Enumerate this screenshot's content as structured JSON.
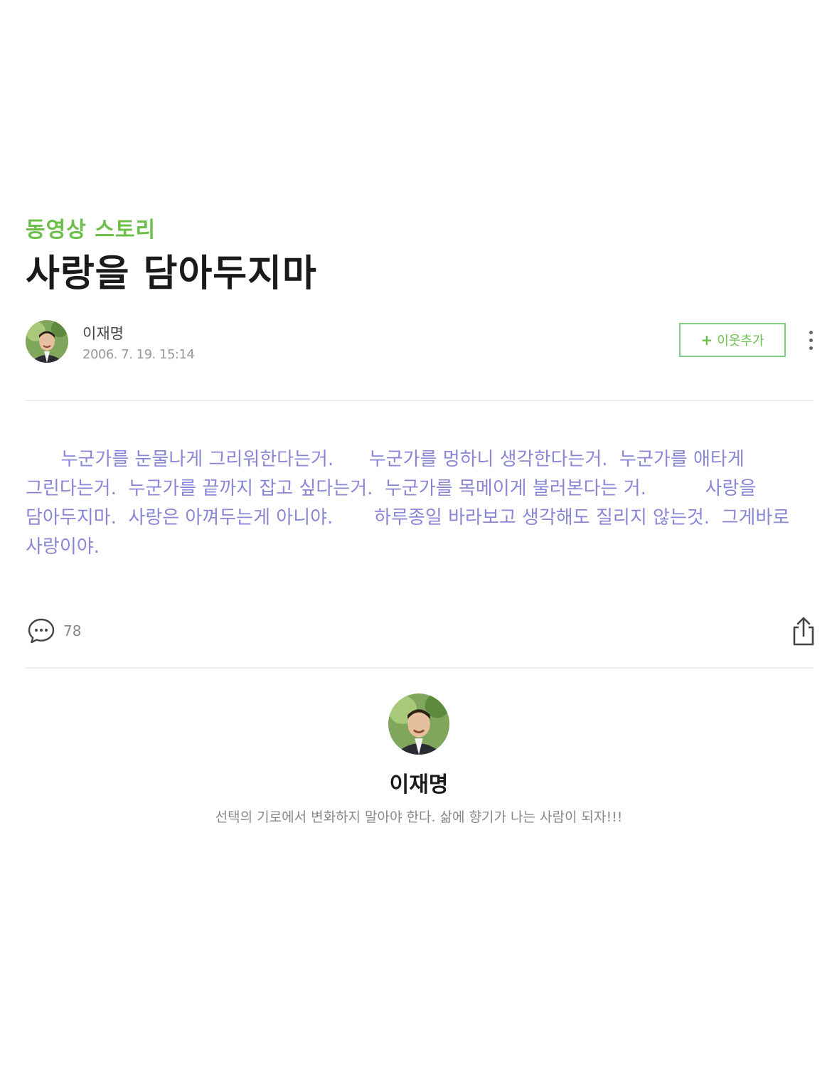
{
  "post": {
    "category": "동영상 스토리",
    "title": "사랑을 담아두지마",
    "author": "이재명",
    "date": "2006. 7. 19. 15:14",
    "neighbor_button": "이웃추가",
    "body": "      누군가를 눈물나게 그리워한다는거.      누군가를 멍하니 생각한다는거.  누군가를 애타게 그린다는거.  누군가를 끝까지 잡고 싶다는거.  누군가를 목메이게 불러본다는 거.          사랑을 담아두지마.  사랑은 아껴두는게 아니야.       하루종일 바라보고 생각해도 질리지 않는것.  그게바로 사랑이야.",
    "comment_count": "78"
  },
  "profile": {
    "name": "이재명",
    "bio": "선택의 기로에서 변화하지 말아야 한다. 삶에 향기가 나는 사람이 되자!!!"
  },
  "colors": {
    "accent_green": "#6cc04a",
    "body_text": "#8a86d6"
  },
  "icons": [
    "avatar",
    "plus-icon",
    "more-icon",
    "comment-icon",
    "share-icon"
  ]
}
